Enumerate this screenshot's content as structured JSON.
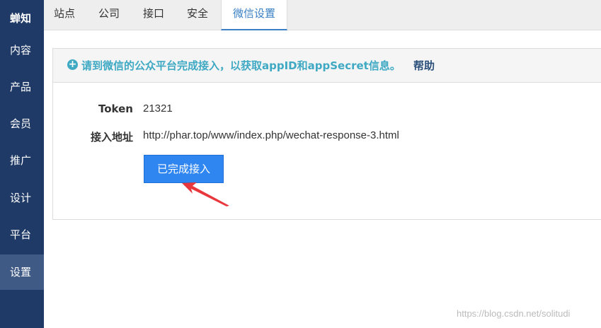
{
  "sidebar": {
    "items": [
      {
        "label": "蝉知"
      },
      {
        "label": "内容"
      },
      {
        "label": "产品"
      },
      {
        "label": "会员"
      },
      {
        "label": "推广"
      },
      {
        "label": "设计"
      },
      {
        "label": "平台"
      },
      {
        "label": "设置"
      }
    ]
  },
  "tabs": [
    {
      "label": "站点"
    },
    {
      "label": "公司"
    },
    {
      "label": "接口"
    },
    {
      "label": "安全"
    },
    {
      "label": "微信设置"
    }
  ],
  "notice": {
    "icon": "plus-circle-icon",
    "text": "请到微信的公众平台完成接入，以获取appID和appSecret信息。",
    "help": "帮助"
  },
  "form": {
    "token_label": "Token",
    "token_value": "21321",
    "url_label": "接入地址",
    "url_value": "http://phar.top/www/index.php/wechat-response-3.html",
    "button": "已完成接入"
  },
  "watermark": "https://blog.csdn.net/solitudi",
  "colors": {
    "sidebar": "#1f3a66",
    "sidebar_active": "#3f5a85",
    "accent": "#3a80c4",
    "notice_text": "#3fa9c4",
    "button": "#2f86f0",
    "arrow": "#e8383d"
  }
}
